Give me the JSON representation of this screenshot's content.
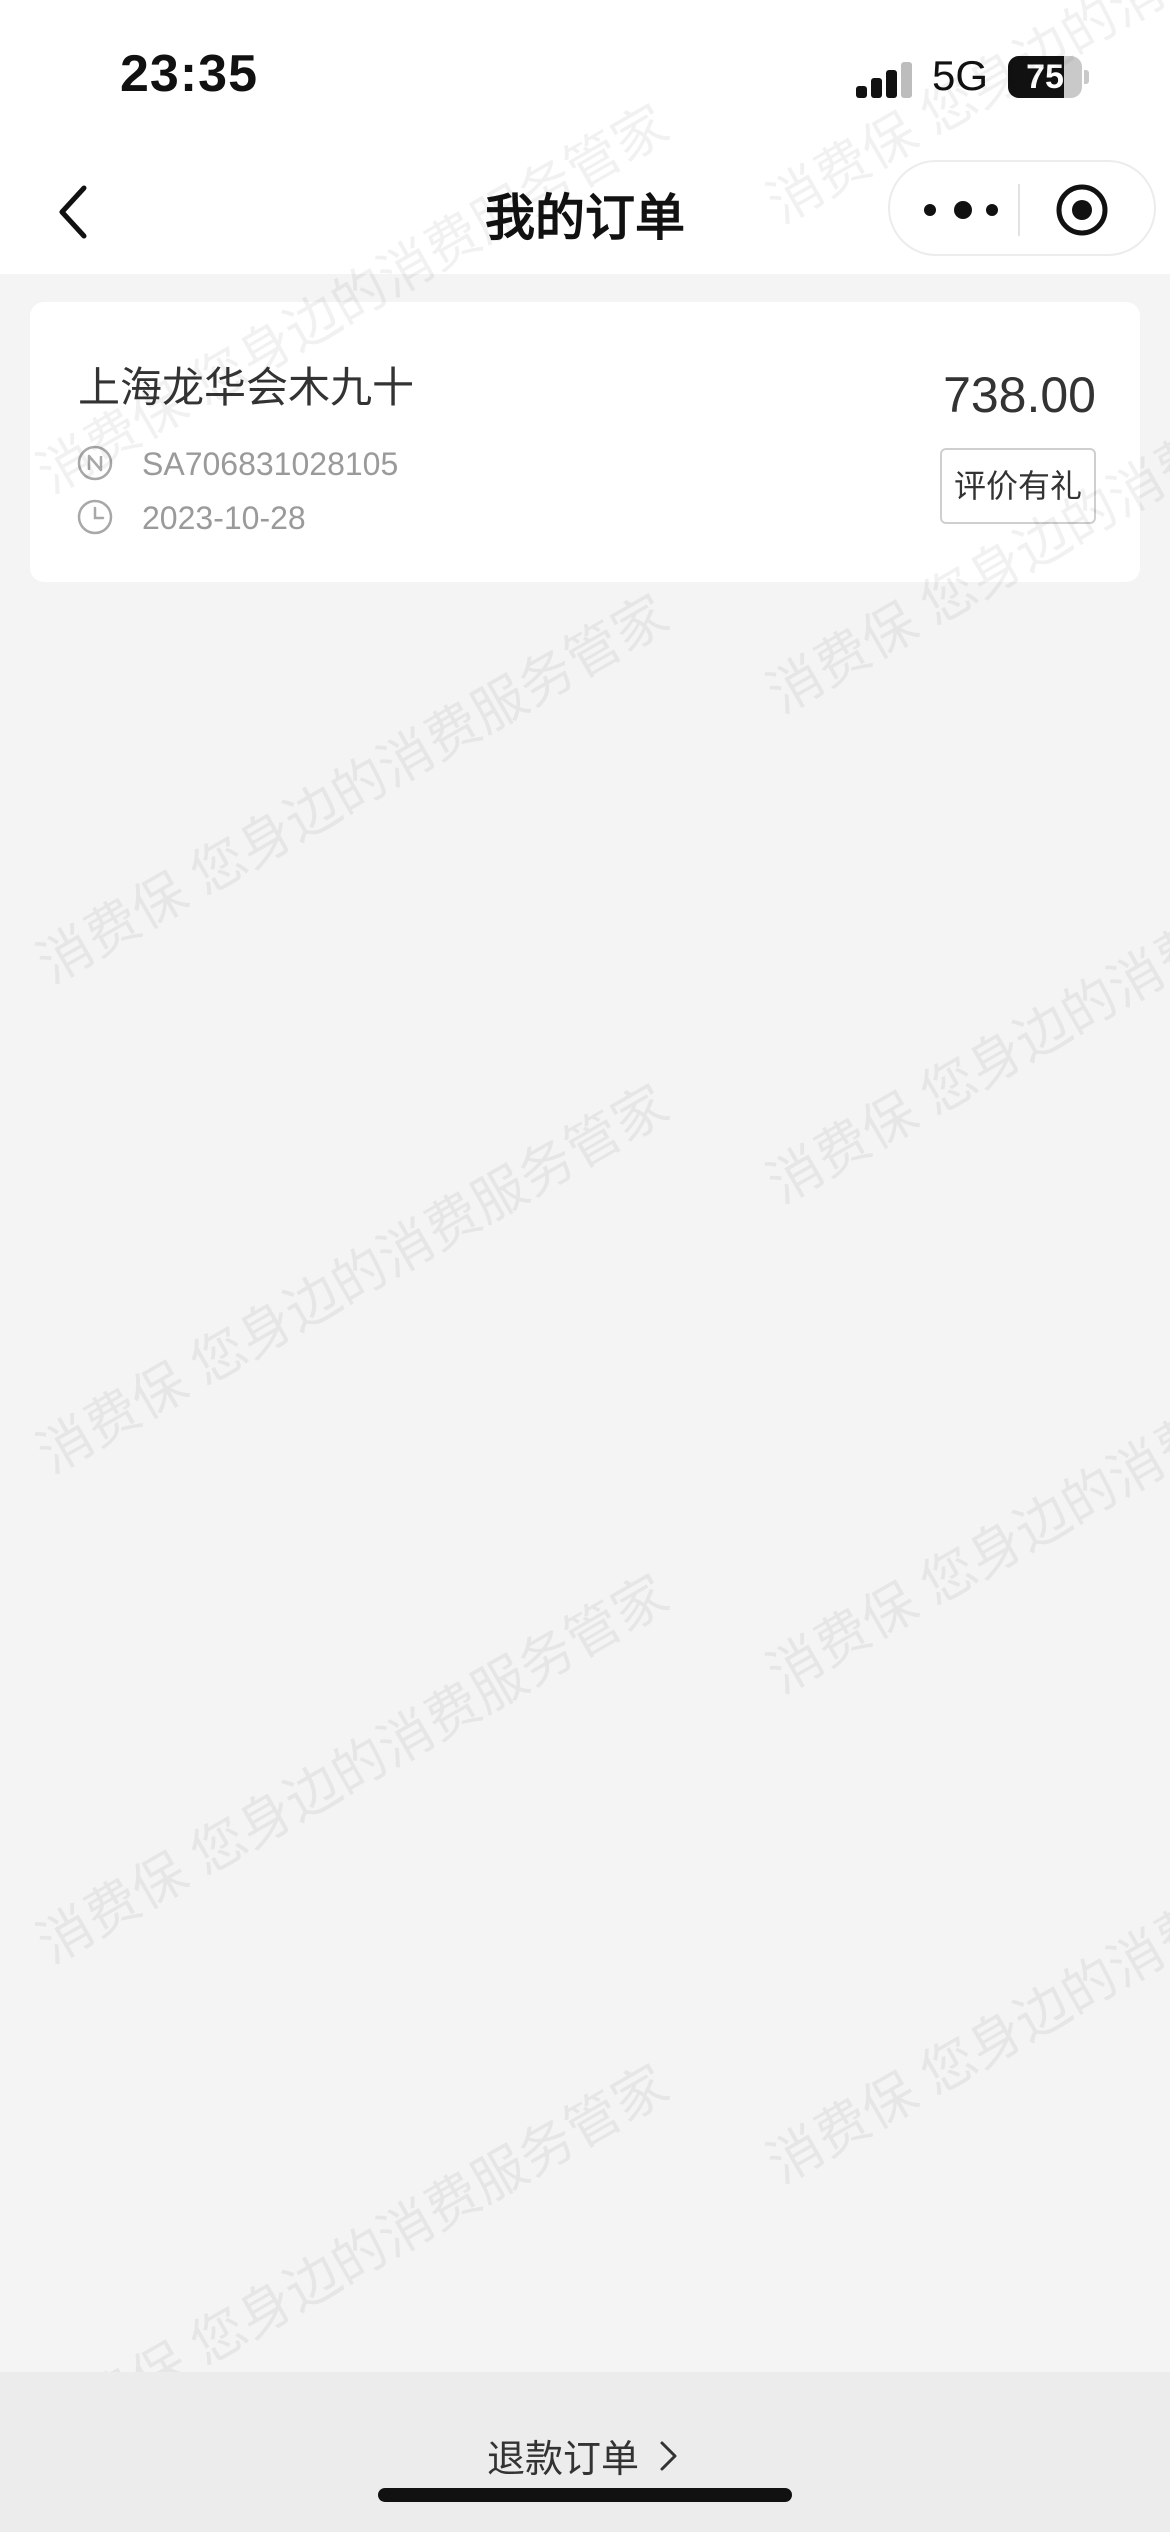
{
  "status_bar": {
    "time": "23:35",
    "network": "5G",
    "battery_level": "75",
    "battery_fraction": 0.75,
    "signal_strength": 3,
    "signal_bars_total": 4
  },
  "nav": {
    "title": "我的订单",
    "back_icon": "chevron-left-icon",
    "more_icon": "more-dots-icon",
    "close_icon": "target-circle-icon"
  },
  "orders": [
    {
      "store_name": "上海龙华会木九十",
      "order_no": "SA706831028105",
      "date": "2023-10-28",
      "price": "738.00",
      "action_label": "评价有礼"
    }
  ],
  "watermark": "消费保 您身边的消费服务管家",
  "footer": {
    "refund_label": "退款订单"
  },
  "colors": {
    "background": "#f4f4f4",
    "card": "#ffffff",
    "text_primary": "#333333",
    "text_secondary": "#9a9a9a"
  }
}
